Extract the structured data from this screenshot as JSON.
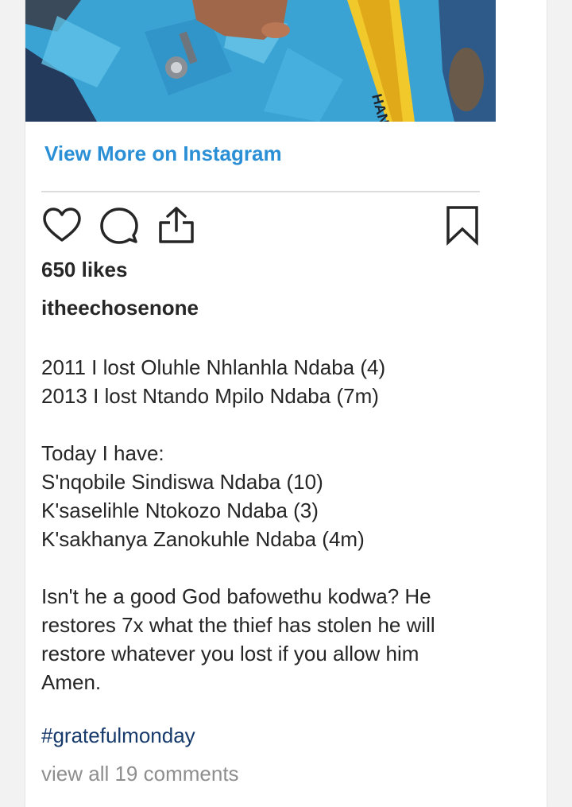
{
  "post": {
    "view_more_label": "View More on Instagram",
    "likes_text": "650 likes",
    "username": "itheechosenone",
    "caption_lines_1": [
      "2011 I lost Oluhle Nhlanhla Ndaba (4)",
      "2013 I lost Ntando Mpilo Ndaba (7m)"
    ],
    "caption_lines_2": [
      "Today I have:",
      "S'nqobile Sindiswa Ndaba (10)",
      "K'saselihle Ntokozo Ndaba (3)",
      "K'sakhanya Zanokuhle Ndaba (4m)"
    ],
    "caption_lines_3": [
      "Isn't he a good God bafowethu kodwa? He",
      "restores 7x what the thief has stolen he will",
      "restore whatever you lost if you allow him",
      "Amen."
    ],
    "hashtag": "#gratefulmonday",
    "comments_link": "view all 19 comments"
  },
  "photo_caption_text": "HANDER",
  "icons": {
    "like": "heart-icon",
    "comment": "comment-icon",
    "share": "share-icon",
    "save": "bookmark-icon"
  },
  "colors": {
    "link_blue": "#2b8fd6",
    "hashtag_navy": "#163a6b",
    "muted_gray": "#8e8e8e",
    "text_dark": "#262626"
  }
}
